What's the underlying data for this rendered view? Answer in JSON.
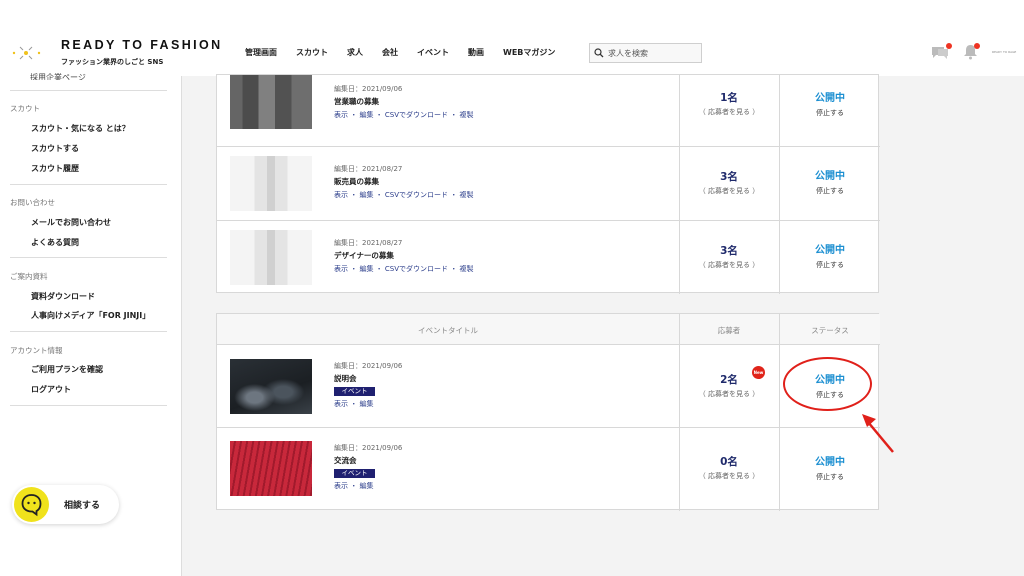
{
  "brand": {
    "title": "READY TO FASHION",
    "subtitle": "ファッション業界のしごと SNS"
  },
  "nav": [
    "管理画面",
    "スカウト",
    "求人",
    "会社",
    "イベント",
    "動画",
    "WEBマガジン"
  ],
  "search": {
    "placeholder": "求人を検索"
  },
  "header_user": "READY TO RAGE",
  "sidebar": {
    "cut_item": "採用企業ページ",
    "sections": [
      {
        "title": "スカウト",
        "items": [
          "スカウト・気になる とは？",
          "スカウトする",
          "スカウト履歴"
        ]
      },
      {
        "title": "お問い合わせ",
        "items": [
          "メールでお問い合わせ",
          "よくある質問"
        ]
      },
      {
        "title": "ご案内資料",
        "items": [
          "資料ダウンロード",
          "人事向けメディア「FOR JINJI」"
        ]
      },
      {
        "title": "アカウント情報",
        "items": [
          "ご利用プランを確認",
          "ログアウト"
        ]
      }
    ],
    "consult_label": "相談する"
  },
  "jobs": [
    {
      "date": "編集日：2021/09/06",
      "title": "営業職の募集",
      "links": "表示 ・ 編集 ・ CSVでダウンロード ・ 複製",
      "count": "1名",
      "apply": "（ 応募者を見る ）",
      "status": "公開中",
      "stop": "停止する"
    },
    {
      "date": "編集日：2021/08/27",
      "title": "販売員の募集",
      "links": "表示 ・ 編集 ・ CSVでダウンロード ・ 複製",
      "count": "3名",
      "apply": "（ 応募者を見る ）",
      "status": "公開中",
      "stop": "停止する"
    },
    {
      "date": "編集日：2021/08/27",
      "title": "デザイナーの募集",
      "links": "表示 ・ 編集 ・ CSVでダウンロード ・ 複製",
      "count": "3名",
      "apply": "（ 応募者を見る ）",
      "status": "公開中",
      "stop": "停止する"
    }
  ],
  "events_header": {
    "title": "イベントタイトル",
    "applicants": "応募者",
    "status": "ステータス"
  },
  "events": [
    {
      "date": "編集日：2021/09/06",
      "title": "説明会",
      "badge": "イベント",
      "links": "表示 ・ 編集",
      "count": "2名",
      "new": "New",
      "apply": "（ 応募者を見る ）",
      "status": "公開中",
      "stop": "停止する"
    },
    {
      "date": "編集日：2021/09/06",
      "title": "交流会",
      "badge": "イベント",
      "links": "表示 ・ 編集",
      "count": "0名",
      "apply": "（ 応募者を見る ）",
      "status": "公開中",
      "stop": "停止する"
    }
  ],
  "colors": {
    "accent_blue": "#1c8fd1",
    "navy": "#1f2a6b",
    "annotation_red": "#e0201a",
    "consult_yellow": "#f0e21c"
  }
}
